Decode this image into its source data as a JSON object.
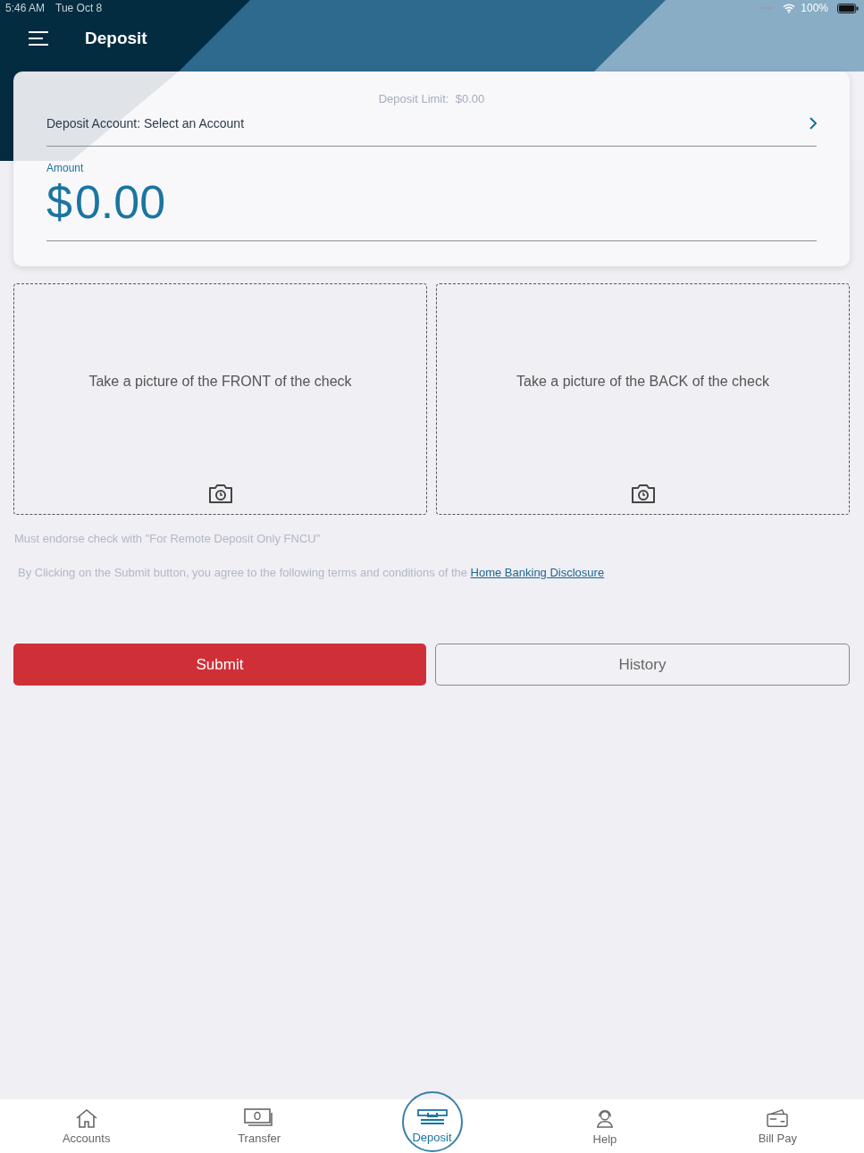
{
  "status_bar": {
    "time": "5:46 AM",
    "date": "Tue Oct 8",
    "battery": "100%"
  },
  "header": {
    "title": "Deposit"
  },
  "deposit_card": {
    "limit_label": "Deposit Limit:",
    "limit_value": "$0.00",
    "account_label": "Deposit Account: Select an Account",
    "amount_label": "Amount",
    "amount_currency": "$",
    "amount_value": "0.00"
  },
  "check_photos": [
    {
      "label": "Take a picture of the FRONT of the check"
    },
    {
      "label": "Take a picture of the BACK of the check"
    }
  ],
  "endorse_note": "Must endorse check with \"For Remote Deposit Only FNCU\"",
  "terms": {
    "text": "By Clicking on the Submit button, you agree to the following terms and conditions of the",
    "link": "Home Banking Disclosure"
  },
  "buttons": [
    {
      "label": "Submit",
      "kind": "primary"
    },
    {
      "label": "History",
      "kind": "secondary"
    }
  ],
  "tab_bar": [
    {
      "label": "Accounts",
      "kind": "home",
      "selected": false
    },
    {
      "label": "Transfer",
      "kind": "cash",
      "selected": false
    },
    {
      "label": "Deposit",
      "kind": "atm",
      "selected": true
    },
    {
      "label": "Help",
      "kind": "headset",
      "selected": false
    },
    {
      "label": "Bill Pay",
      "kind": "wallet",
      "selected": false
    }
  ]
}
